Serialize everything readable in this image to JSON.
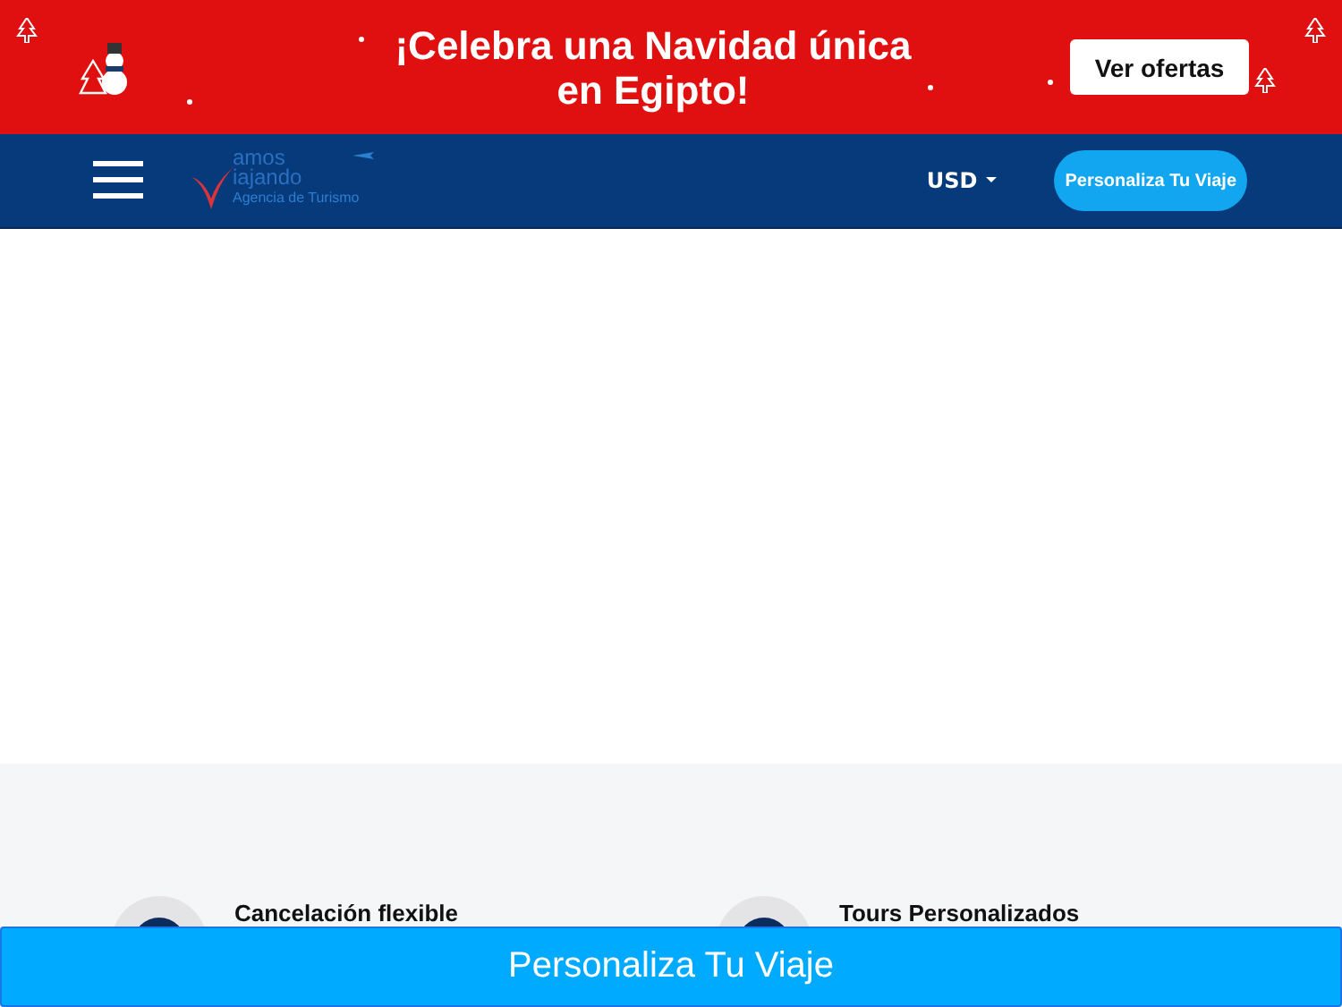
{
  "promo_banner": {
    "headline_line_1": "¡Celebra una Navidad única",
    "headline_line_2": "en Egipto!",
    "button": "Ver ofertas"
  },
  "navbar": {
    "logo": {
      "line_1": "amos",
      "line_2": "iajando",
      "tagline": "Agencia de Turismo"
    },
    "currency": "USD",
    "button": "Personaliza Tu Viaje"
  },
  "features": [
    {
      "title": "Cancelación flexible"
    },
    {
      "title": "Tours Personalizados"
    }
  ],
  "bottom_button": "Personaliza Tu Viaje"
}
